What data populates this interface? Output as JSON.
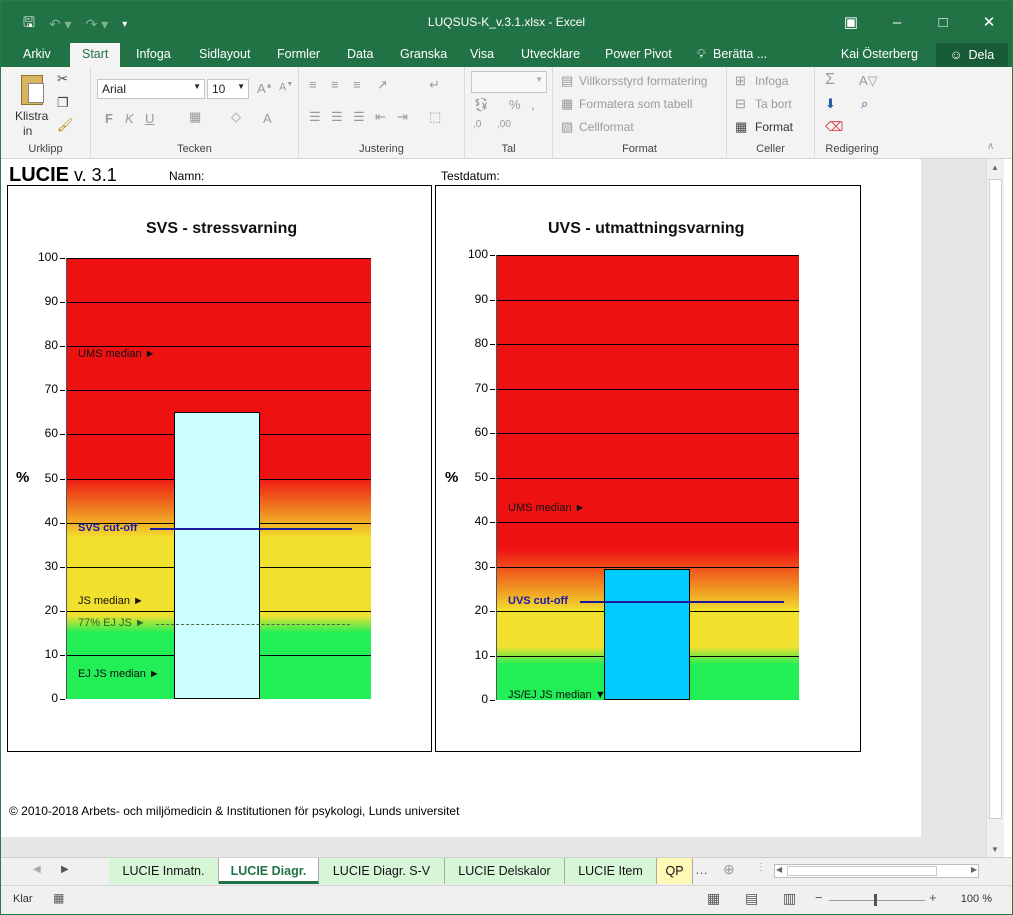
{
  "window": {
    "title": "LUQSUS-K_v.3.1.xlsx - Excel"
  },
  "ribbon_tabs": [
    "Arkiv",
    "Start",
    "Infoga",
    "Sidlayout",
    "Formler",
    "Data",
    "Granska",
    "Visa",
    "Utvecklare",
    "Power Pivot",
    "Berätta ..."
  ],
  "active_tab": "Start",
  "user": {
    "name": "Kai Österberg",
    "share": "Dela"
  },
  "ribbon": {
    "clipboard": {
      "paste": "Klistra",
      "paste2": "in",
      "label": "Urklipp"
    },
    "font": {
      "name": "Arial",
      "size": "10",
      "label": "Tecken"
    },
    "alignment": {
      "label": "Justering"
    },
    "number": {
      "label": "Tal",
      "percent": "%"
    },
    "styles": {
      "cond": "Villkorsstyrd formatering",
      "table": "Formatera som tabell",
      "cell": "Cellformat",
      "label": "Format"
    },
    "cells": {
      "insert": "Infoga",
      "delete": "Ta bort",
      "format": "Format",
      "label": "Celler"
    },
    "editing": {
      "label": "Redigering"
    }
  },
  "sheet": {
    "app_name": "LUCIE",
    "version": "v. 3.1",
    "name_label": "Namn:",
    "date_label": "Testdatum:",
    "copyright": "© 2010-2018 Arbets- och miljömedicin & Institutionen för psykologi, Lunds universitet"
  },
  "chart_data": [
    {
      "type": "bar",
      "title": "SVS - stressvarning",
      "ylabel": "%",
      "ylim": [
        0,
        100
      ],
      "yticks": [
        "0",
        "10",
        "20",
        "30",
        "40",
        "50",
        "60",
        "70",
        "80",
        "90",
        "100"
      ],
      "values": [
        65
      ],
      "bar_color": "#ccffff",
      "background_zones": [
        {
          "from": 0,
          "to": 17,
          "color": "#22ee55"
        },
        {
          "from": 17,
          "to": 38.5,
          "color": "#f2e02e"
        },
        {
          "from": 38.5,
          "to": 100,
          "color": "#ee1111"
        }
      ],
      "cutoff": {
        "label": "SVS cut-off",
        "value": 38.5
      },
      "markers": [
        {
          "label": "UMS median ►",
          "value": 78
        },
        {
          "label": "JS median  ►",
          "value": 22
        },
        {
          "label": "77% EJ JS ►",
          "value": 17
        },
        {
          "label": "EJ JS median ►",
          "value": 5.5
        }
      ],
      "grid": true
    },
    {
      "type": "bar",
      "title": "UVS - utmattningsvarning",
      "ylabel": "%",
      "ylim": [
        0,
        100
      ],
      "yticks": [
        "0",
        "10",
        "20",
        "30",
        "40",
        "50",
        "60",
        "70",
        "80",
        "90",
        "100"
      ],
      "values": [
        29.5
      ],
      "bar_color": "#00ccff",
      "background_zones": [
        {
          "from": 0,
          "to": 10,
          "color": "#22ee55"
        },
        {
          "from": 10,
          "to": 22,
          "color": "#f2e02e"
        },
        {
          "from": 22,
          "to": 100,
          "color": "#ee1111"
        }
      ],
      "cutoff": {
        "label": "UVS cut-off",
        "value": 22
      },
      "markers": [
        {
          "label": "UMS median ►",
          "value": 43
        },
        {
          "label": "JS/EJ JS median ▼",
          "value": 1
        }
      ],
      "grid": true
    }
  ],
  "sheet_tabs": [
    {
      "label": "LUCIE Inmatn.",
      "active": false
    },
    {
      "label": "LUCIE Diagr.",
      "active": true
    },
    {
      "label": "LUCIE Diagr. S-V",
      "active": false
    },
    {
      "label": "LUCIE Delskalor",
      "active": false
    },
    {
      "label": "LUCIE Item",
      "active": false
    },
    {
      "label": "QP",
      "active": false
    }
  ],
  "status": {
    "ready": "Klar",
    "zoom": "100 %"
  }
}
